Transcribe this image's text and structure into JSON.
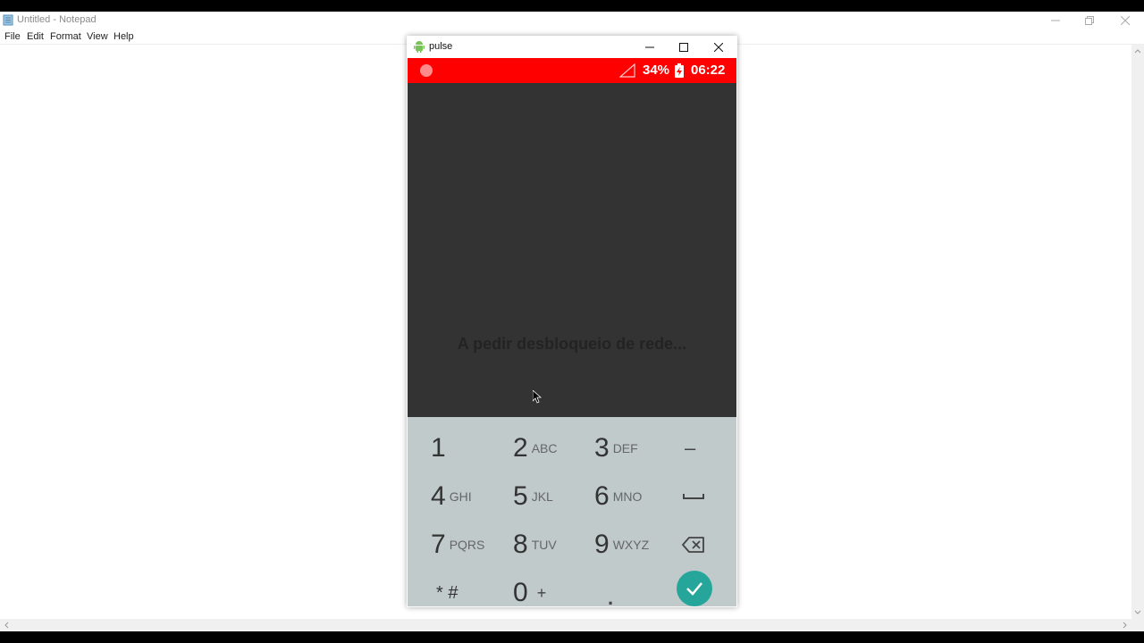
{
  "notepad": {
    "title": "Untitled - Notepad",
    "menu": [
      "File",
      "Edit",
      "Format",
      "View",
      "Help"
    ],
    "controls": {
      "minimize": "minimize-icon",
      "maximize": "restore-icon",
      "close": "close-icon"
    }
  },
  "emulator": {
    "title": "pulse",
    "icon": "android-icon",
    "status_bar": {
      "color": "#ff0000",
      "battery": "34%",
      "time": "06:22"
    },
    "message": "A pedir desbloqueio de rede...",
    "keypad": {
      "rows": [
        [
          {
            "digit": "1",
            "letters": ""
          },
          {
            "digit": "2",
            "letters": "ABC"
          },
          {
            "digit": "3",
            "letters": "DEF"
          },
          {
            "symbol": "–"
          }
        ],
        [
          {
            "digit": "4",
            "letters": "GHI"
          },
          {
            "digit": "5",
            "letters": "JKL"
          },
          {
            "digit": "6",
            "letters": "MNO"
          },
          {
            "symbol": "space-icon"
          }
        ],
        [
          {
            "digit": "7",
            "letters": "PQRS"
          },
          {
            "digit": "8",
            "letters": "TUV"
          },
          {
            "digit": "9",
            "letters": "WXYZ"
          },
          {
            "symbol": "backspace-icon"
          }
        ],
        [
          {
            "symbol": "* #"
          },
          {
            "digit": "0",
            "letters": "+"
          },
          {
            "symbol": "."
          },
          {
            "symbol": "check-icon"
          }
        ]
      ],
      "keypad_color": "#c0cacb",
      "ok_color": "#26a69a"
    }
  }
}
